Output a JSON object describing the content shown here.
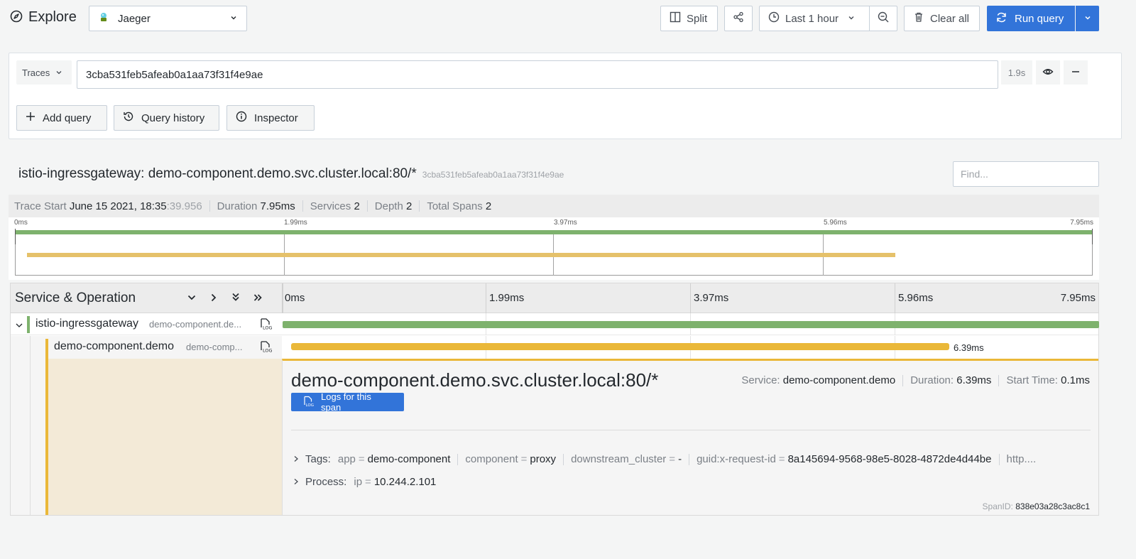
{
  "header": {
    "title": "Explore",
    "datasource": "Jaeger",
    "split_label": "Split",
    "time_range": "Last 1 hour",
    "clear_label": "Clear all",
    "run_label": "Run query"
  },
  "query": {
    "type_label": "Traces",
    "trace_id": "3cba531feb5afeab0a1aa73f31f4e9ae",
    "duration": "1.9s",
    "add_query_label": "Add query",
    "history_label": "Query history",
    "inspector_label": "Inspector"
  },
  "trace": {
    "title": "istio-ingressgateway: demo-component.demo.svc.cluster.local:80/*",
    "trace_id": "3cba531feb5afeab0a1aa73f31f4e9ae",
    "find_placeholder": "Find...",
    "start_label": "Trace Start",
    "start_value": "June 15 2021, 18:35",
    "start_ms": ":39.956",
    "duration_label": "Duration",
    "duration_value": "7.95ms",
    "services_label": "Services",
    "services_value": "2",
    "depth_label": "Depth",
    "depth_value": "2",
    "spans_label": "Total Spans",
    "spans_value": "2"
  },
  "minimap": {
    "ticks": [
      "0ms",
      "1.99ms",
      "3.97ms",
      "5.96ms",
      "7.95ms"
    ]
  },
  "timeline": {
    "header_label": "Service & Operation",
    "ticks": [
      "0ms",
      "1.99ms",
      "3.97ms",
      "5.96ms",
      "7.95ms"
    ]
  },
  "spans": [
    {
      "service": "istio-ingressgateway",
      "operation": "demo-component.de...",
      "color": "#7eb26d",
      "start_fraction": 0.0,
      "end_fraction": 1.0,
      "duration_label": ""
    },
    {
      "service": "demo-component.demo",
      "operation": "demo-comp...",
      "color": "#eab839",
      "start_fraction": 0.0125,
      "end_fraction": 0.817,
      "duration_label": "6.39ms"
    }
  ],
  "detail": {
    "operation": "demo-component.demo.svc.cluster.local:80/*",
    "service_label": "Service:",
    "service_value": "demo-component.demo",
    "duration_label": "Duration:",
    "duration_value": "6.39ms",
    "start_label": "Start Time:",
    "start_value": "0.1ms",
    "logs_button": "Logs for this span",
    "tags_label": "Tags:",
    "tags": [
      {
        "key": "app",
        "value": "demo-component"
      },
      {
        "key": "component",
        "value": "proxy"
      },
      {
        "key": "downstream_cluster",
        "value": "-"
      },
      {
        "key": "guid:x-request-id",
        "value": "8a145694-9568-98e5-8028-4872de4d44be"
      }
    ],
    "tags_overflow": "http....",
    "process_label": "Process:",
    "process_key": "ip",
    "process_value": "10.244.2.101",
    "span_id_label": "SpanID:",
    "span_id_value": "838e03a28c3ac8c1"
  },
  "colors": {
    "primary": "#3274d9",
    "service_1": "#7eb26d",
    "service_2": "#eab839"
  }
}
